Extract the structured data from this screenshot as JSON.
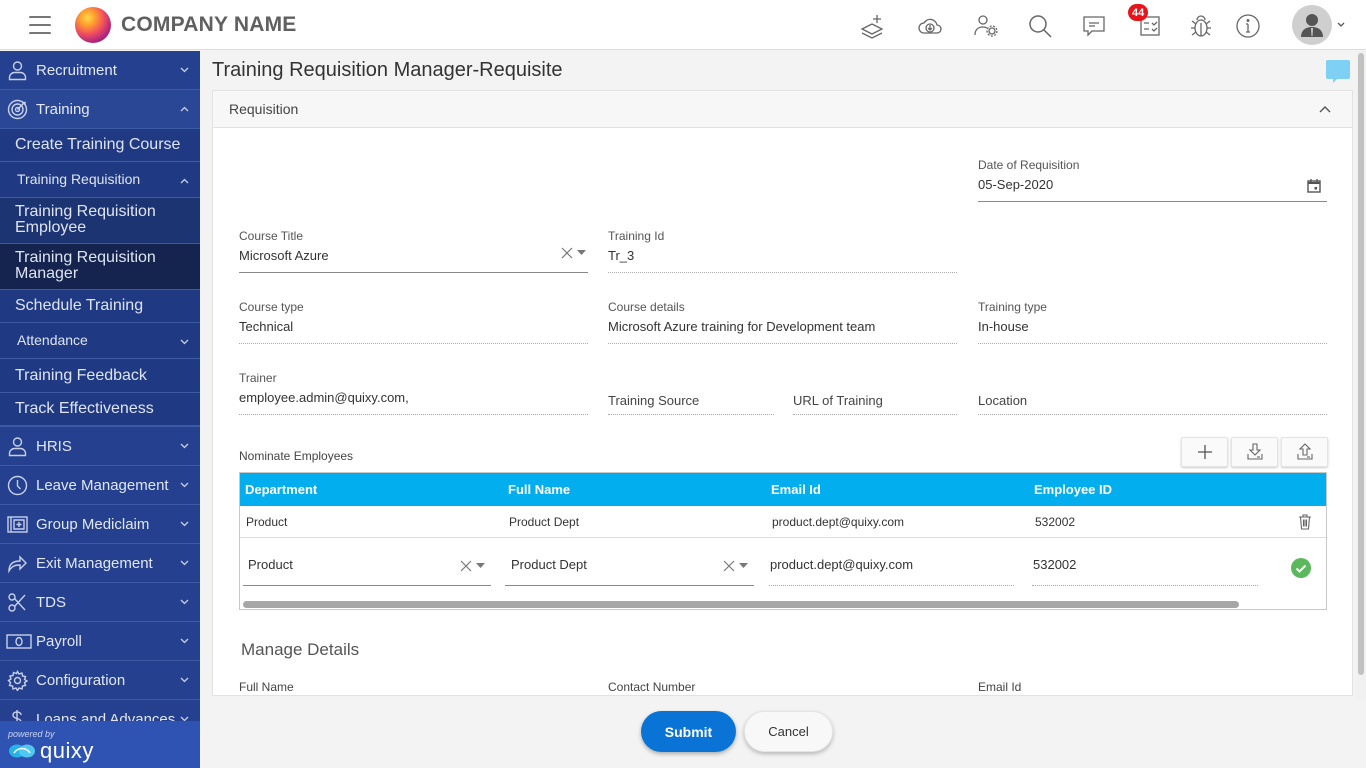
{
  "header": {
    "brand": "COMPANY NAME",
    "notification_count": "44",
    "icons": [
      "add-layers-icon",
      "cloud-download-icon",
      "user-settings-icon",
      "search-icon",
      "chat-icon",
      "tasks-icon",
      "bug-icon",
      "info-icon"
    ]
  },
  "sidebar": {
    "items": [
      {
        "label": "Recruitment",
        "icon": "user-icon",
        "expanded": false
      },
      {
        "label": "Training",
        "icon": "target-icon",
        "expanded": true
      }
    ],
    "training_children": {
      "create_course": "Create Training Course",
      "requisition": "Training Requisition",
      "requisition_employee_line1": "Training Requisition",
      "requisition_employee_line2": "Employee",
      "requisition_manager_line1": "Training Requisition",
      "requisition_manager_line2": "Manager",
      "schedule": "Schedule Training",
      "attendance": "Attendance",
      "feedback": "Training Feedback",
      "effectiveness": "Track Effectiveness"
    },
    "modules": [
      {
        "label": "HRIS",
        "icon": "user-icon"
      },
      {
        "label": "Leave Management",
        "icon": "clock-icon"
      },
      {
        "label": "Group Mediclaim",
        "icon": "medical-icon"
      },
      {
        "label": "Exit Management",
        "icon": "exit-arrow-icon"
      },
      {
        "label": "TDS",
        "icon": "scissors-icon"
      },
      {
        "label": "Payroll",
        "icon": "money-icon"
      },
      {
        "label": "Configuration",
        "icon": "gear-icon"
      },
      {
        "label": "Loans and Advances",
        "icon": "dollar-icon"
      }
    ],
    "powered_by": "powered by",
    "powered_brand": "quixy"
  },
  "page": {
    "title": "Training Requisition Manager-Requisite",
    "panel_title": "Requisition",
    "fields": {
      "date_label": "Date of Requisition",
      "date_value": "05-Sep-2020",
      "course_title_label": "Course Title",
      "course_title_value": "Microsoft Azure",
      "training_id_label": "Training Id",
      "training_id_value": "Tr_3",
      "course_type_label": "Course type",
      "course_type_value": "Technical",
      "course_details_label": "Course details",
      "course_details_value": "Microsoft Azure training for Development team",
      "training_type_label": "Training type",
      "training_type_value": "In-house",
      "trainer_label": "Trainer",
      "trainer_value": "employee.admin@quixy.com,",
      "training_source_label": "Training Source",
      "url_label": "URL of Training",
      "location_label": "Location"
    },
    "nominate": {
      "label": "Nominate Employees",
      "columns": [
        "Department",
        "Full Name",
        "Email Id",
        "Employee ID"
      ],
      "rows": [
        {
          "department": "Product",
          "full_name": "Product Dept",
          "email": "product.dept@quixy.com",
          "employee_id": "532002"
        }
      ],
      "edit_row": {
        "department": "Product",
        "full_name": "Product Dept",
        "email": "product.dept@quixy.com",
        "employee_id": "532002"
      }
    },
    "manage": {
      "title": "Manage Details",
      "full_name_label": "Full Name",
      "contact_label": "Contact Number",
      "email_label": "Email Id"
    },
    "buttons": {
      "submit": "Submit",
      "cancel": "Cancel"
    }
  },
  "colors": {
    "sidebar_bg": "#24408e",
    "grid_header": "#03aeef",
    "submit": "#0a74d6",
    "badge": "#e8141c",
    "success": "#5cb85c"
  }
}
